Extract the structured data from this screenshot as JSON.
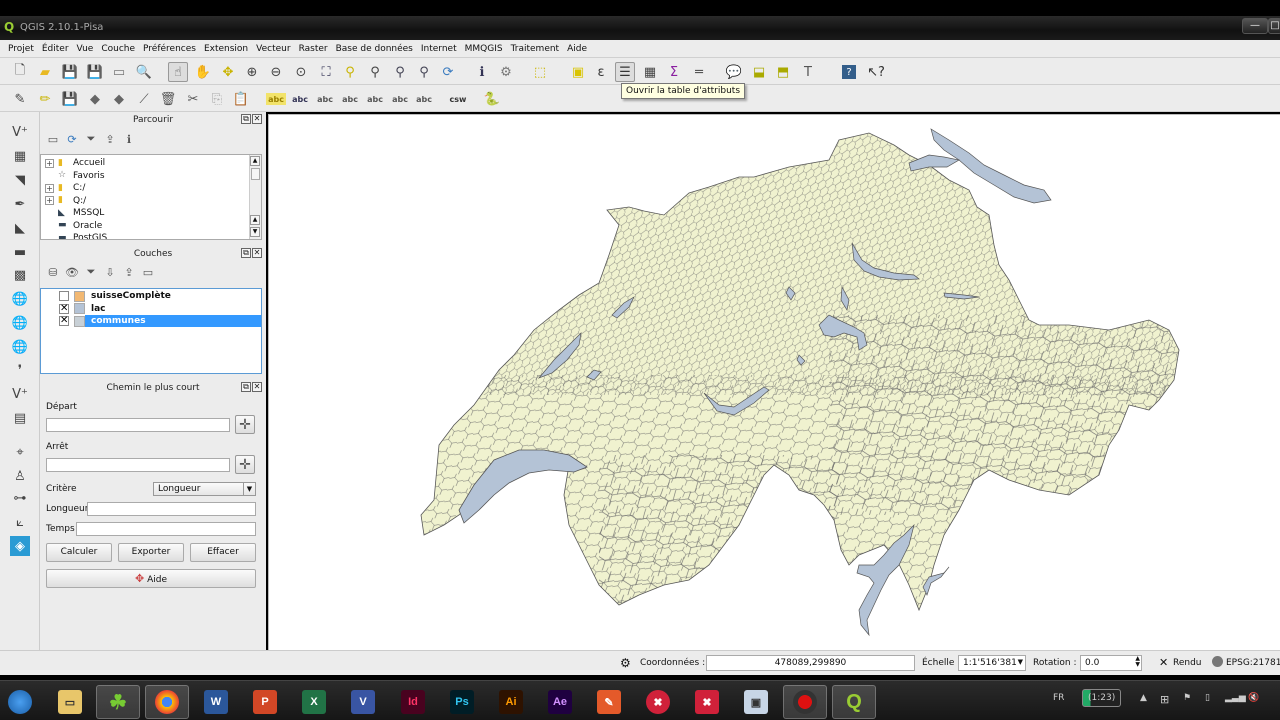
{
  "window": {
    "title": "QGIS 2.10.1-Pisa"
  },
  "menubar": [
    "Projet",
    "Éditer",
    "Vue",
    "Couche",
    "Préférences",
    "Extension",
    "Vecteur",
    "Raster",
    "Base de données",
    "Internet",
    "MMQGIS",
    "Traitement",
    "Aide"
  ],
  "toolbar1_icons": [
    "new-project-icon",
    "open-project-icon",
    "save-project-icon",
    "save-as-icon",
    "new-print-composer-icon",
    "composer-manager-icon",
    "touch-zoom-pan-icon",
    "pan-icon",
    "pan-to-selection-icon",
    "zoom-in-icon",
    "zoom-out-icon",
    "zoom-1-1-icon",
    "zoom-full-icon",
    "zoom-to-selection-icon",
    "zoom-to-layer-icon",
    "zoom-last-icon",
    "zoom-next-icon",
    "refresh-icon",
    "identify-icon",
    "action-icon",
    "select-icon",
    "deselect-icon",
    "select-by-expression-icon",
    "attribute-table-icon",
    "field-calculator-icon",
    "statistics-icon",
    "measure-icon",
    "map-tips-icon",
    "new-bookmark-icon",
    "show-bookmarks-icon",
    "text-annotation-icon",
    "help-icon",
    "whats-this-icon"
  ],
  "toolbar2_icons": [
    "current-edits-icon",
    "toggle-editing-icon",
    "save-edits-icon",
    "add-feature-icon",
    "move-feature-icon",
    "node-tool-icon",
    "delete-selected-icon",
    "cut-features-icon",
    "copy-features-icon",
    "paste-features-icon",
    "label-icon",
    "layer-labeling-icon",
    "pin-labels-icon",
    "show-hide-labels-icon",
    "move-label-icon",
    "rotate-label-icon",
    "change-label-icon",
    "csw-icon",
    "python-console-icon"
  ],
  "tooltip": "Ouvrir la table d'attributs",
  "left_toolbar_icons": [
    "add-vector-layer-icon",
    "add-raster-layer-icon",
    "add-postgis-layer-icon",
    "add-spatialite-layer-icon",
    "add-mssql-layer-icon",
    "add-oracle-layer-icon",
    "add-db2-layer-icon",
    "add-wms-layer-icon",
    "add-wcs-layer-icon",
    "add-wfs-layer-icon",
    "add-delimited-text-icon",
    "new-shapefile-icon",
    "new-spatialite-icon",
    "capture-point-icon",
    "digitize-icon",
    "split-icon",
    "georeferencer-icon",
    "road-graph-icon"
  ],
  "browser_panel": {
    "title": "Parcourir",
    "tools": [
      "add-selected-icon",
      "refresh-icon",
      "filter-icon",
      "collapse-all-icon",
      "properties-icon"
    ],
    "items": [
      {
        "label": "Accueil",
        "icon": "folder-icon",
        "expandable": true
      },
      {
        "label": "Favoris",
        "icon": "star-icon",
        "expandable": false
      },
      {
        "label": "C:/",
        "icon": "folder-icon",
        "expandable": true
      },
      {
        "label": "Q:/",
        "icon": "folder-icon",
        "expandable": true
      },
      {
        "label": "MSSQL",
        "icon": "mssql-icon",
        "expandable": false
      },
      {
        "label": "Oracle",
        "icon": "oracle-icon",
        "expandable": false
      },
      {
        "label": "PostGIS",
        "icon": "postgis-icon",
        "expandable": false
      }
    ]
  },
  "layers_panel": {
    "title": "Couches",
    "tools": [
      "open-layer-styling-icon",
      "add-group-icon",
      "filter-legend-icon",
      "expand-all-icon",
      "collapse-all-icon",
      "remove-layer-icon"
    ],
    "layers": [
      {
        "name": "suisseComplète",
        "checked": false,
        "color": "#f2b872",
        "selected": false
      },
      {
        "name": "lac",
        "checked": true,
        "color": "#b4c3d6",
        "selected": false
      },
      {
        "name": "communes",
        "checked": true,
        "color": "#c8d0d6",
        "selected": true
      }
    ]
  },
  "shortest_path_panel": {
    "title": "Chemin le plus court",
    "start_label": "Départ",
    "start_value": "",
    "stop_label": "Arrêt",
    "stop_value": "",
    "criterion_label": "Critère",
    "criterion_value": "Longueur",
    "length_label": "Longueur",
    "length_value": "",
    "time_label": "Temps",
    "time_value": "",
    "calculate_button": "Calculer",
    "export_button": "Exporter",
    "clear_button": "Effacer",
    "help_button": "Aide"
  },
  "map": {
    "land_fill": "#f0f2cf",
    "lake_fill": "#b4c3d6",
    "border_color": "#555555"
  },
  "statusbar": {
    "coordinates_label": "Coordonnées :",
    "coordinates_value": "478089,299890",
    "scale_label": "Échelle",
    "scale_value": "1:1'516'381",
    "rotation_label": "Rotation :",
    "rotation_value": "0.0",
    "render_label": "Rendu",
    "render_checked": true,
    "crs": "EPSG:21781"
  },
  "taskbar": {
    "apps": [
      {
        "name": "start-button",
        "label": ""
      },
      {
        "name": "explorer",
        "label": ""
      },
      {
        "name": "clover",
        "label": ""
      },
      {
        "name": "chrome",
        "label": ""
      },
      {
        "name": "word",
        "label": "W"
      },
      {
        "name": "powerpoint",
        "label": "P"
      },
      {
        "name": "excel",
        "label": "X"
      },
      {
        "name": "visio",
        "label": "V"
      },
      {
        "name": "indesign",
        "label": "Id"
      },
      {
        "name": "photoshop",
        "label": "Ps"
      },
      {
        "name": "illustrator",
        "label": "Ai"
      },
      {
        "name": "after-effects",
        "label": "Ae"
      },
      {
        "name": "pen-tool-app",
        "label": ""
      },
      {
        "name": "xmind",
        "label": ""
      },
      {
        "name": "xmind-alt",
        "label": ""
      },
      {
        "name": "virtualbox",
        "label": ""
      },
      {
        "name": "recorder",
        "label": ""
      },
      {
        "name": "qgis",
        "label": ""
      }
    ],
    "language": "FR",
    "battery": "(1:23)"
  }
}
